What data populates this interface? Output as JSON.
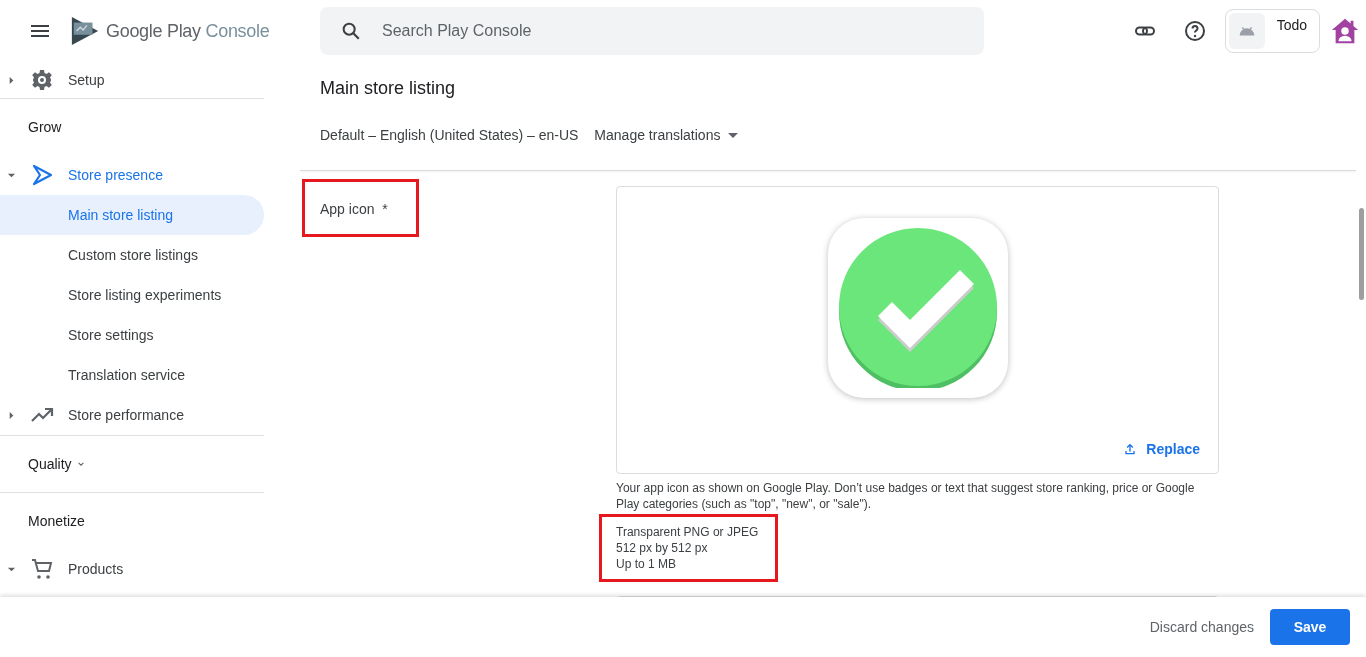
{
  "header": {
    "brand": {
      "primary": "Google Play",
      "secondary": "Console"
    },
    "search": {
      "placeholder": "Search Play Console"
    },
    "app": {
      "name": "Todo"
    }
  },
  "sidebar": {
    "items": [
      {
        "kind": "item",
        "label": "Setup",
        "expanded": false,
        "selected": false
      },
      {
        "kind": "divider"
      },
      {
        "kind": "section",
        "label": "Grow"
      },
      {
        "kind": "item",
        "label": "Store presence",
        "expanded": true,
        "selected": false,
        "children": [
          {
            "label": "Main store listing",
            "selected": true
          },
          {
            "label": "Custom store listings",
            "selected": false
          },
          {
            "label": "Store listing experiments",
            "selected": false
          },
          {
            "label": "Store settings",
            "selected": false
          },
          {
            "label": "Translation service",
            "selected": false
          }
        ]
      },
      {
        "kind": "item",
        "label": "Store performance",
        "expanded": false,
        "selected": false
      },
      {
        "kind": "divider"
      },
      {
        "kind": "section",
        "label": "Quality",
        "dropdown": true
      },
      {
        "kind": "divider"
      },
      {
        "kind": "section",
        "label": "Monetize"
      },
      {
        "kind": "item",
        "label": "Products",
        "expanded": true,
        "selected": false
      }
    ]
  },
  "main": {
    "title": "Main store listing",
    "language": "Default – English (United States) – en-US",
    "manage_translations": "Manage translations",
    "app_icon": {
      "label": "App icon",
      "required_mark": "*",
      "highlighted": true,
      "replace": "Replace",
      "help": "Your app icon as shown on Google Play. Don’t use badges or text that suggest store ranking, price or Google Play categories (such as \"top\", \"new\", or \"sale\").",
      "specs": [
        "Transparent PNG or JPEG",
        "512 px by 512 px",
        "Up to 1 MB"
      ],
      "specs_highlighted": true
    }
  },
  "footer": {
    "discard": "Discard changes",
    "save": "Save"
  }
}
